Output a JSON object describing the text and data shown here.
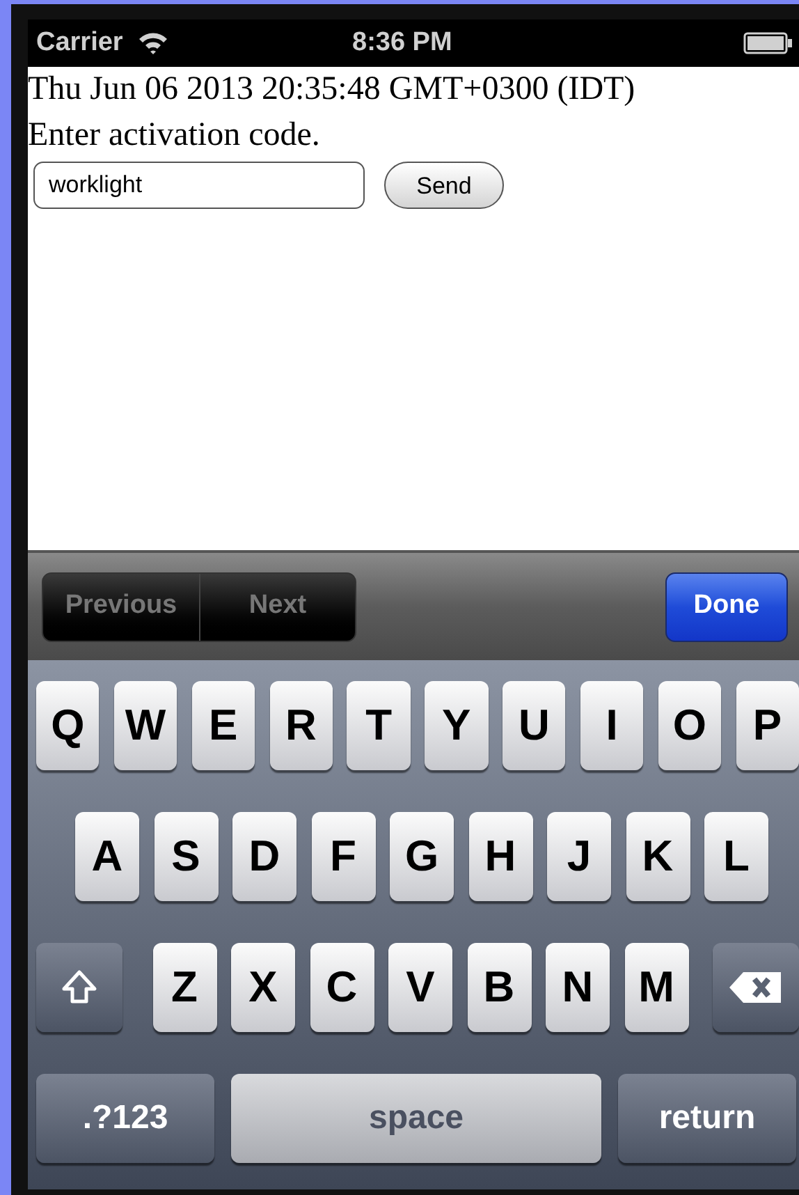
{
  "status_bar": {
    "carrier": "Carrier",
    "time": "8:36 PM"
  },
  "page": {
    "date_line": "Thu Jun 06 2013 20:35:48 GMT+0300 (IDT)",
    "prompt": "Enter activation code.",
    "code_field": {
      "value": "worklight"
    },
    "send_button": "Send"
  },
  "toolbar": {
    "nav": [
      {
        "label": "Previous",
        "disabled": true
      },
      {
        "label": "Next",
        "disabled": true
      }
    ],
    "done": "Done"
  },
  "keyboard": {
    "rows": [
      {
        "keys": [
          {
            "kind": "letter",
            "label": "Q"
          },
          {
            "kind": "letter",
            "label": "W"
          },
          {
            "kind": "letter",
            "label": "E"
          },
          {
            "kind": "letter",
            "label": "R"
          },
          {
            "kind": "letter",
            "label": "T"
          },
          {
            "kind": "letter",
            "label": "Y"
          },
          {
            "kind": "letter",
            "label": "U"
          },
          {
            "kind": "letter",
            "label": "I"
          },
          {
            "kind": "letter",
            "label": "O"
          },
          {
            "kind": "letter",
            "label": "P"
          }
        ]
      },
      {
        "keys": [
          {
            "kind": "letter",
            "label": "A"
          },
          {
            "kind": "letter",
            "label": "S"
          },
          {
            "kind": "letter",
            "label": "D"
          },
          {
            "kind": "letter",
            "label": "F"
          },
          {
            "kind": "letter",
            "label": "G"
          },
          {
            "kind": "letter",
            "label": "H"
          },
          {
            "kind": "letter",
            "label": "J"
          },
          {
            "kind": "letter",
            "label": "K"
          },
          {
            "kind": "letter",
            "label": "L"
          }
        ]
      },
      {
        "keys": [
          {
            "kind": "shift"
          },
          {
            "kind": "letter",
            "label": "Z"
          },
          {
            "kind": "letter",
            "label": "X"
          },
          {
            "kind": "letter",
            "label": "C"
          },
          {
            "kind": "letter",
            "label": "V"
          },
          {
            "kind": "letter",
            "label": "B"
          },
          {
            "kind": "letter",
            "label": "N"
          },
          {
            "kind": "letter",
            "label": "M"
          },
          {
            "kind": "delete"
          }
        ]
      }
    ],
    "bottom_keys": [
      {
        "kind": "mode",
        "label": ".?123"
      },
      {
        "kind": "space",
        "label": "space"
      },
      {
        "kind": "return",
        "label": "return"
      }
    ]
  }
}
